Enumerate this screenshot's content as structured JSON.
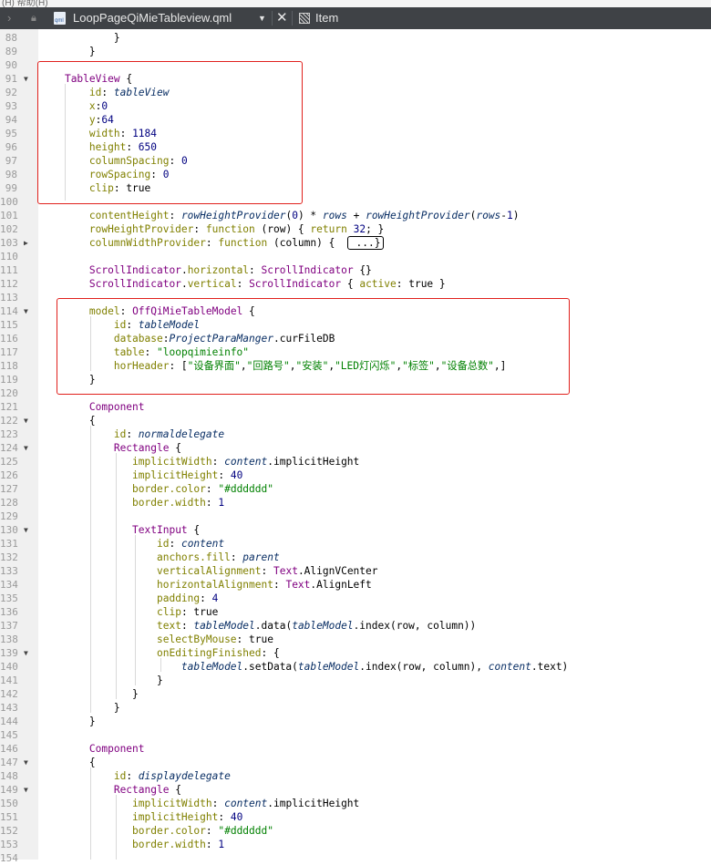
{
  "toolbar": {
    "file_name": "LoopPageQiMieTableview.qml",
    "file_icon_text": "qml",
    "nav_back": "›",
    "dropdown": "▼",
    "close": "✕",
    "symbol": "Item"
  },
  "editor": {
    "lines": [
      {
        "n": "88",
        "fold": "",
        "html": "            }"
      },
      {
        "n": "89",
        "fold": "",
        "html": "        }"
      },
      {
        "n": "90",
        "fold": "",
        "html": ""
      },
      {
        "n": "91",
        "fold": "▼",
        "html": "    <span class=\"ty\">TableView</span> {"
      },
      {
        "n": "92",
        "fold": "",
        "html": "        <span class=\"kw\">id</span>: <span class=\"it\">tableView</span>"
      },
      {
        "n": "93",
        "fold": "",
        "html": "        <span class=\"kw\">x</span>:<span class=\"nb\">0</span>"
      },
      {
        "n": "94",
        "fold": "",
        "html": "        <span class=\"kw\">y</span>:<span class=\"nb\">64</span>"
      },
      {
        "n": "95",
        "fold": "",
        "html": "        <span class=\"kw\">width</span>: <span class=\"nb\">1184</span>"
      },
      {
        "n": "96",
        "fold": "",
        "html": "        <span class=\"kw\">height</span>: <span class=\"nb\">650</span>"
      },
      {
        "n": "97",
        "fold": "",
        "html": "        <span class=\"kw\">columnSpacing</span>: <span class=\"nb\">0</span>"
      },
      {
        "n": "98",
        "fold": "",
        "html": "        <span class=\"kw\">rowSpacing</span>: <span class=\"nb\">0</span>"
      },
      {
        "n": "99",
        "fold": "",
        "html": "        <span class=\"kw\">clip</span>: true"
      },
      {
        "n": "100",
        "fold": "",
        "html": ""
      },
      {
        "n": "101",
        "fold": "",
        "html": "        <span class=\"kw\">contentHeight</span>: <span class=\"it\">rowHeightProvider</span>(<span class=\"nb\">0</span>) * <span class=\"it\">rows</span> + <span class=\"it\">rowHeightProvider</span>(<span class=\"it\">rows</span>-<span class=\"nb\">1</span>)"
      },
      {
        "n": "102",
        "fold": "",
        "html": "        <span class=\"kw\">rowHeightProvider</span>: <span class=\"kw\">function</span> (row) { <span class=\"kw\">return</span> <span class=\"nb\">32</span>; }"
      },
      {
        "n": "103",
        "fold": "▶",
        "html": "        <span class=\"kw\">columnWidthProvider</span>: <span class=\"kw\">function</span> (column) {  <span class=\"collapsed\"> ...}</span>"
      },
      {
        "n": "110",
        "fold": "",
        "html": ""
      },
      {
        "n": "111",
        "fold": "",
        "html": "        <span class=\"ty\">ScrollIndicator</span>.<span class=\"kw\">horizontal</span>: <span class=\"ty\">ScrollIndicator</span> {}"
      },
      {
        "n": "112",
        "fold": "",
        "html": "        <span class=\"ty\">ScrollIndicator</span>.<span class=\"kw\">vertical</span>: <span class=\"ty\">ScrollIndicator</span> { <span class=\"kw\">active</span>: true }"
      },
      {
        "n": "113",
        "fold": "",
        "html": ""
      },
      {
        "n": "114",
        "fold": "▼",
        "html": "        <span class=\"kw\">model</span>: <span class=\"ty\">OffQiMieTableModel</span> {"
      },
      {
        "n": "115",
        "fold": "",
        "html": "            <span class=\"kw\">id</span>: <span class=\"it\">tableModel</span>"
      },
      {
        "n": "116",
        "fold": "",
        "html": "            <span class=\"kw\">database</span>:<span class=\"it\">ProjectParaManger</span>.curFileDB"
      },
      {
        "n": "117",
        "fold": "",
        "html": "            <span class=\"kw\">table</span>: <span class=\"st\">\"loopqimieinfo\"</span>"
      },
      {
        "n": "118",
        "fold": "",
        "html": "            <span class=\"kw\">horHeader</span>: [<span class=\"st\">\"设备界面\"</span>,<span class=\"st\">\"回路号\"</span>,<span class=\"st\">\"安装\"</span>,<span class=\"st\">\"LED灯闪烁\"</span>,<span class=\"st\">\"标签\"</span>,<span class=\"st\">\"设备总数\"</span>,]"
      },
      {
        "n": "119",
        "fold": "",
        "html": "        }"
      },
      {
        "n": "120",
        "fold": "",
        "html": ""
      },
      {
        "n": "121",
        "fold": "",
        "html": "        <span class=\"ty\">Component</span>"
      },
      {
        "n": "122",
        "fold": "▼",
        "html": "        {"
      },
      {
        "n": "123",
        "fold": "",
        "html": "            <span class=\"kw\">id</span>: <span class=\"it\">normaldelegate</span>"
      },
      {
        "n": "124",
        "fold": "▼",
        "html": "            <span class=\"ty\">Rectangle</span> {"
      },
      {
        "n": "125",
        "fold": "",
        "html": "               <span class=\"kw\">implicitWidth</span>: <span class=\"it\">content</span>.implicitHeight"
      },
      {
        "n": "126",
        "fold": "",
        "html": "               <span class=\"kw\">implicitHeight</span>: <span class=\"nb\">40</span>"
      },
      {
        "n": "127",
        "fold": "",
        "html": "               <span class=\"kw\">border.color</span>: <span class=\"st\">\"#dddddd\"</span>"
      },
      {
        "n": "128",
        "fold": "",
        "html": "               <span class=\"kw\">border.width</span>: <span class=\"nb\">1</span>"
      },
      {
        "n": "129",
        "fold": "",
        "html": ""
      },
      {
        "n": "130",
        "fold": "▼",
        "html": "               <span class=\"ty\">TextInput</span> {"
      },
      {
        "n": "131",
        "fold": "",
        "html": "                   <span class=\"kw\">id</span>: <span class=\"it\">content</span>"
      },
      {
        "n": "132",
        "fold": "",
        "html": "                   <span class=\"kw\">anchors.fill</span>: <span class=\"it\">parent</span>"
      },
      {
        "n": "133",
        "fold": "",
        "html": "                   <span class=\"kw\">verticalAlignment</span>: <span class=\"ty\">Text</span>.AlignVCenter"
      },
      {
        "n": "134",
        "fold": "",
        "html": "                   <span class=\"kw\">horizontalAlignment</span>: <span class=\"ty\">Text</span>.AlignLeft"
      },
      {
        "n": "135",
        "fold": "",
        "html": "                   <span class=\"kw\">padding</span>: <span class=\"nb\">4</span>"
      },
      {
        "n": "136",
        "fold": "",
        "html": "                   <span class=\"kw\">clip</span>: true"
      },
      {
        "n": "137",
        "fold": "",
        "html": "                   <span class=\"kw\">text</span>: <span class=\"it\">tableModel</span>.data(<span class=\"it\">tableModel</span>.index(row, column))"
      },
      {
        "n": "138",
        "fold": "",
        "html": "                   <span class=\"kw\">selectByMouse</span>: true"
      },
      {
        "n": "139",
        "fold": "▼",
        "html": "                   <span class=\"kw\">onEditingFinished</span>: {"
      },
      {
        "n": "140",
        "fold": "",
        "html": "                       <span class=\"it\">tableModel</span>.setData(<span class=\"it\">tableModel</span>.index(row, column), <span class=\"it\">content</span>.text)"
      },
      {
        "n": "141",
        "fold": "",
        "html": "                   }"
      },
      {
        "n": "142",
        "fold": "",
        "html": "               }"
      },
      {
        "n": "143",
        "fold": "",
        "html": "            }"
      },
      {
        "n": "144",
        "fold": "",
        "html": "        }"
      },
      {
        "n": "145",
        "fold": "",
        "html": ""
      },
      {
        "n": "146",
        "fold": "",
        "html": "        <span class=\"ty\">Component</span>"
      },
      {
        "n": "147",
        "fold": "▼",
        "html": "        {"
      },
      {
        "n": "148",
        "fold": "",
        "html": "            <span class=\"kw\">id</span>: <span class=\"it\">displaydelegate</span>"
      },
      {
        "n": "149",
        "fold": "▼",
        "html": "            <span class=\"ty\">Rectangle</span> {"
      },
      {
        "n": "150",
        "fold": "",
        "html": "               <span class=\"kw\">implicitWidth</span>: <span class=\"it\">content</span>.implicitHeight"
      },
      {
        "n": "151",
        "fold": "",
        "html": "               <span class=\"kw\">implicitHeight</span>: <span class=\"nb\">40</span>"
      },
      {
        "n": "152",
        "fold": "",
        "html": "               <span class=\"kw\">border.color</span>: <span class=\"st\">\"#dddddd\"</span>"
      },
      {
        "n": "153",
        "fold": "",
        "html": "               <span class=\"kw\">border.width</span>: <span class=\"nb\">1</span>"
      },
      {
        "n": "154",
        "fold": "",
        "html": ""
      }
    ]
  },
  "colors": {
    "highlight_box": "#e0201c",
    "keyword": "#808000",
    "type": "#800080",
    "string": "#008000",
    "number": "#000080"
  }
}
